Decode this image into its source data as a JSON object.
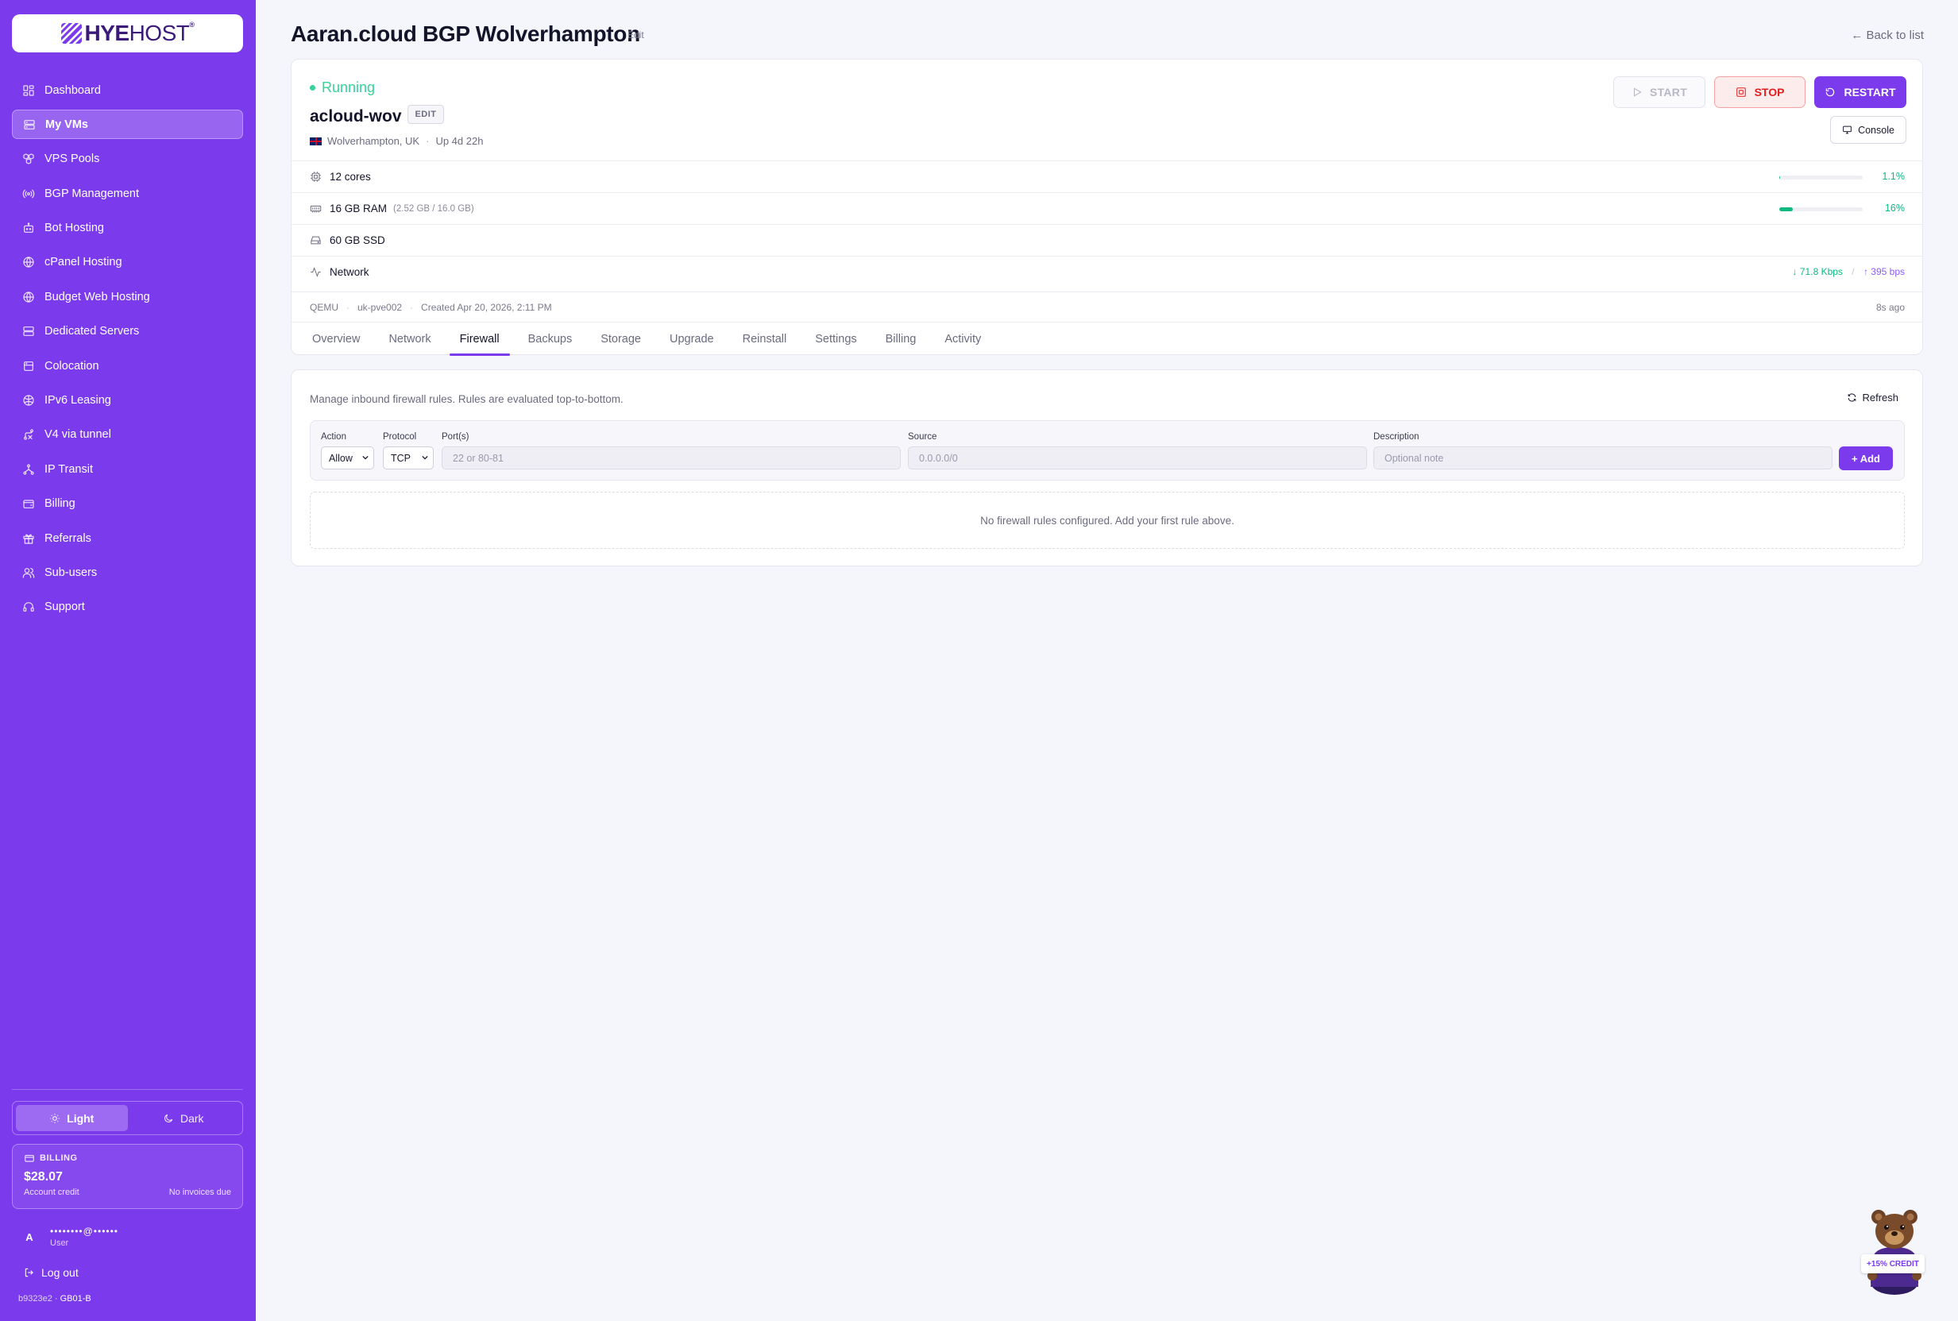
{
  "brand": {
    "name_bold": "HYE",
    "name_rest": "HOST",
    "trademark": "®"
  },
  "sidebar": {
    "items": [
      {
        "label": "Dashboard",
        "icon": "grid-icon"
      },
      {
        "label": "My VMs",
        "icon": "server-icon",
        "active": true
      },
      {
        "label": "VPS Pools",
        "icon": "boxes-icon"
      },
      {
        "label": "BGP Management",
        "icon": "radio-icon"
      },
      {
        "label": "Bot Hosting",
        "icon": "bot-icon"
      },
      {
        "label": "cPanel Hosting",
        "icon": "globe-icon"
      },
      {
        "label": "Budget Web Hosting",
        "icon": "globe-icon"
      },
      {
        "label": "Dedicated Servers",
        "icon": "server-stack-icon"
      },
      {
        "label": "Colocation",
        "icon": "building-icon"
      },
      {
        "label": "IPv6 Leasing",
        "icon": "network-icon"
      },
      {
        "label": "V4 via tunnel",
        "icon": "route-icon"
      },
      {
        "label": "IP Transit",
        "icon": "transit-icon"
      },
      {
        "label": "Billing",
        "icon": "wallet-icon"
      },
      {
        "label": "Referrals",
        "icon": "gift-icon"
      },
      {
        "label": "Sub-users",
        "icon": "users-icon"
      },
      {
        "label": "Support",
        "icon": "headset-icon"
      }
    ],
    "theme": {
      "light": "Light",
      "dark": "Dark",
      "selected": "Light"
    },
    "billing": {
      "label": "BILLING",
      "amount": "$28.07",
      "credit_label": "Account credit",
      "invoices": "No invoices due"
    },
    "user": {
      "initial": "A",
      "email": "••••••••@••••••",
      "role": "User"
    },
    "logout": "Log out",
    "build": {
      "hash": "b9323e2",
      "sep": "·",
      "region": "GB01-B"
    }
  },
  "header": {
    "title": "Aaran.cloud BGP Wolverhampton",
    "edit": "Edit",
    "back": "← Back to list"
  },
  "vm": {
    "status": "Running",
    "name": "acloud-wov",
    "edit": "EDIT",
    "location": "Wolverhampton, UK",
    "uptime": "Up 4d 22h",
    "buttons": {
      "start": "START",
      "stop": "STOP",
      "restart": "RESTART",
      "console": "Console"
    },
    "specs": {
      "cpu": {
        "label": "12 cores",
        "pct": "1.1%",
        "fill": 0.011
      },
      "ram": {
        "label": "16 GB RAM",
        "sub": "(2.52 GB / 16.0 GB)",
        "pct": "16%",
        "fill": 0.16
      },
      "disk": {
        "label": "60 GB SSD"
      },
      "network": {
        "label": "Network",
        "down": "↓ 71.8 Kbps",
        "sep": "/",
        "up": "↑ 395 bps"
      }
    },
    "meta": {
      "hypervisor": "QEMU",
      "node": "uk-pve002",
      "created": "Created Apr 20, 2026, 2:11 PM",
      "updated": "8s ago"
    },
    "tabs": [
      "Overview",
      "Network",
      "Firewall",
      "Backups",
      "Storage",
      "Upgrade",
      "Reinstall",
      "Settings",
      "Billing",
      "Activity"
    ],
    "active_tab": "Firewall"
  },
  "firewall": {
    "description": "Manage inbound firewall rules. Rules are evaluated top-to-bottom.",
    "refresh": "Refresh",
    "form": {
      "action_label": "Action",
      "action_value": "Allow",
      "protocol_label": "Protocol",
      "protocol_value": "TCP",
      "ports_label": "Port(s)",
      "ports_placeholder": "22 or 80-81",
      "source_label": "Source",
      "source_placeholder": "0.0.0.0/0",
      "description_label": "Description",
      "description_placeholder": "Optional note",
      "add": "+ Add"
    },
    "empty": "No firewall rules configured. Add your first rule above."
  },
  "mascot": {
    "badge": "+15% CREDIT"
  },
  "colors": {
    "accent": "#7c3aed",
    "success": "#10b981",
    "danger": "#e02020"
  }
}
